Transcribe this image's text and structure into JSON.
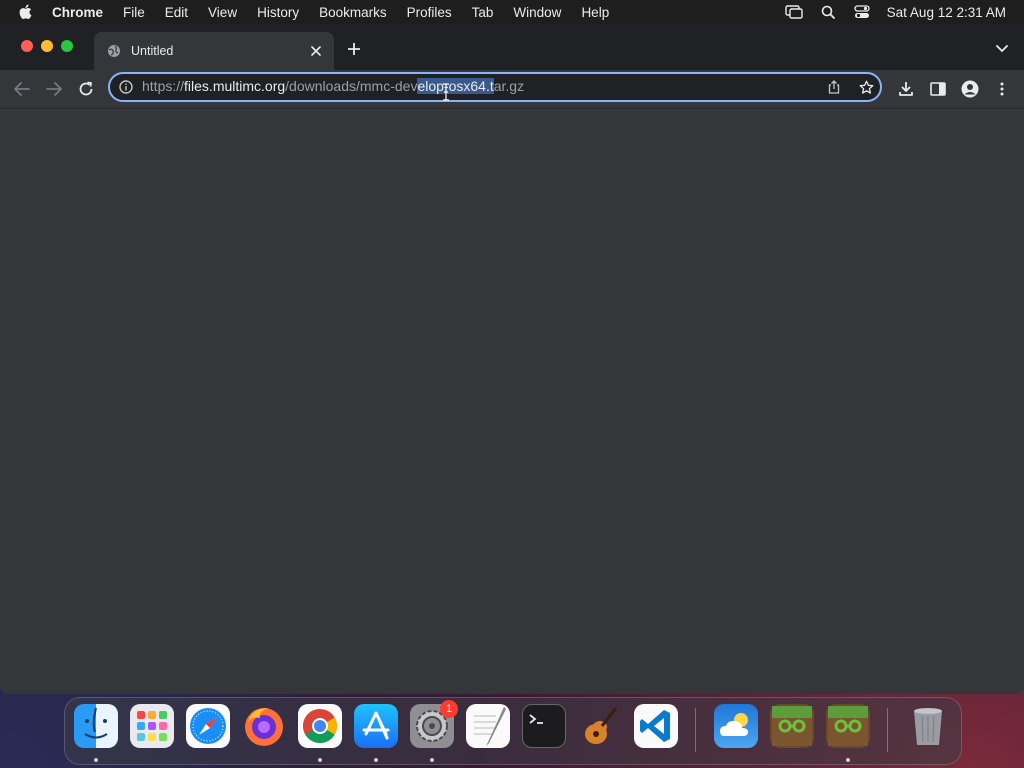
{
  "menubar": {
    "app_name": "Chrome",
    "items": [
      "File",
      "Edit",
      "View",
      "History",
      "Bookmarks",
      "Profiles",
      "Tab",
      "Window",
      "Help"
    ],
    "clock": "Sat Aug 12  2:31 AM"
  },
  "tab": {
    "title": "Untitled"
  },
  "address_bar": {
    "url_scheme": "https://",
    "url_host": "files.multimc.org",
    "url_path_before": "/downloads/mmc-dev",
    "url_selected": "elop-osx64.t",
    "url_path_after": "ar.gz"
  },
  "dock": {
    "apps": [
      "Finder",
      "Launchpad",
      "Safari",
      "Firefox",
      "Google Chrome",
      "App Store",
      "System Settings",
      "TextEdit",
      "Terminal",
      "GarageBand",
      "Visual Studio Code",
      "Weather",
      "MultiMC",
      "MultiMC",
      "Trash"
    ],
    "system_settings_badge": "1"
  },
  "colors": {
    "accent": "#8ab4f8",
    "selection": "#3b5a8c",
    "window_bg": "#35363a",
    "tabstrip_bg": "#202124"
  }
}
